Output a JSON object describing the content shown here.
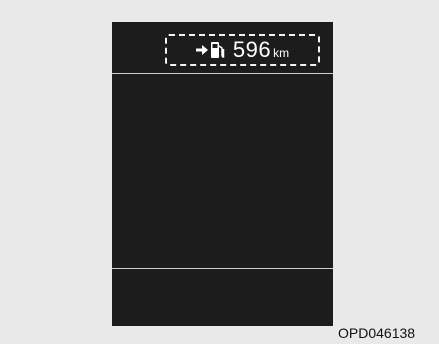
{
  "display": {
    "range_value": "596",
    "range_unit": "km",
    "icons": [
      "arrow-right-icon",
      "fuel-pump-icon"
    ]
  },
  "figure_code": "OPD046138"
}
